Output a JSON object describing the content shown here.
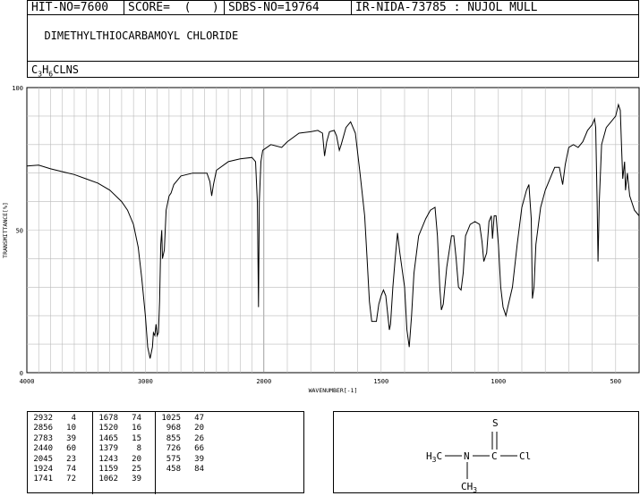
{
  "header": {
    "hit_no": "HIT-NO=7600",
    "score": "SCORE=  (   )",
    "sdbs_no": "SDBS-NO=19764",
    "ir_info": "IR-NIDA-73785 : NUJOL MULL"
  },
  "compound_name": "DIMETHYLTHIOCARBAMOYL CHLORIDE",
  "formula": {
    "c": "C",
    "c_n": "3",
    "h": "H",
    "h_n": "6",
    "rest": "CLNS"
  },
  "chart_data": {
    "type": "line",
    "title": "",
    "xlabel": "WAVENUMBER[-1]",
    "ylabel": "TRANSMITTANCE[%]",
    "xlim": [
      4000,
      400
    ],
    "ylim": [
      0,
      100
    ],
    "x_ticks": [
      4000,
      3000,
      2000,
      1500,
      1000,
      500
    ],
    "y_ticks": [
      0,
      50,
      100
    ],
    "grid": true,
    "series": [
      {
        "points": [
          [
            4000,
            72.5
          ],
          [
            3900,
            72.8
          ],
          [
            3800,
            71.5
          ],
          [
            3700,
            70.5
          ],
          [
            3600,
            69.5
          ],
          [
            3500,
            68
          ],
          [
            3400,
            66.5
          ],
          [
            3300,
            64
          ],
          [
            3200,
            60
          ],
          [
            3150,
            57
          ],
          [
            3100,
            52
          ],
          [
            3060,
            44
          ],
          [
            3030,
            33
          ],
          [
            3000,
            20
          ],
          [
            2980,
            9
          ],
          [
            2960,
            5
          ],
          [
            2940,
            9
          ],
          [
            2932,
            14
          ],
          [
            2920,
            13
          ],
          [
            2910,
            17
          ],
          [
            2900,
            13
          ],
          [
            2890,
            14
          ],
          [
            2880,
            25
          ],
          [
            2870,
            45
          ],
          [
            2862,
            50
          ],
          [
            2856,
            40
          ],
          [
            2840,
            43
          ],
          [
            2825,
            57
          ],
          [
            2800,
            62
          ],
          [
            2783,
            63
          ],
          [
            2760,
            66
          ],
          [
            2700,
            69
          ],
          [
            2600,
            70
          ],
          [
            2480,
            70
          ],
          [
            2455,
            67
          ],
          [
            2440,
            62
          ],
          [
            2425,
            66
          ],
          [
            2400,
            71
          ],
          [
            2300,
            74
          ],
          [
            2200,
            75
          ],
          [
            2100,
            75.5
          ],
          [
            2070,
            74
          ],
          [
            2055,
            60
          ],
          [
            2045,
            23
          ],
          [
            2038,
            60
          ],
          [
            2025,
            74
          ],
          [
            2010,
            78
          ],
          [
            1970,
            80
          ],
          [
            1924,
            79
          ],
          [
            1900,
            81
          ],
          [
            1850,
            84
          ],
          [
            1800,
            84.5
          ],
          [
            1770,
            85
          ],
          [
            1750,
            84
          ],
          [
            1741,
            76
          ],
          [
            1732,
            81
          ],
          [
            1720,
            84.5
          ],
          [
            1700,
            85
          ],
          [
            1690,
            83
          ],
          [
            1678,
            78
          ],
          [
            1670,
            80
          ],
          [
            1650,
            86
          ],
          [
            1630,
            88
          ],
          [
            1610,
            84
          ],
          [
            1590,
            70
          ],
          [
            1570,
            55
          ],
          [
            1560,
            40
          ],
          [
            1550,
            25
          ],
          [
            1540,
            18
          ],
          [
            1520,
            18
          ],
          [
            1510,
            24
          ],
          [
            1500,
            27
          ],
          [
            1490,
            29
          ],
          [
            1480,
            27
          ],
          [
            1465,
            15
          ],
          [
            1460,
            17
          ],
          [
            1450,
            30
          ],
          [
            1440,
            40
          ],
          [
            1430,
            49
          ],
          [
            1420,
            42
          ],
          [
            1400,
            30
          ],
          [
            1390,
            15
          ],
          [
            1380,
            9
          ],
          [
            1370,
            20
          ],
          [
            1360,
            35
          ],
          [
            1340,
            48
          ],
          [
            1310,
            54
          ],
          [
            1290,
            57
          ],
          [
            1270,
            58
          ],
          [
            1260,
            48
          ],
          [
            1250,
            30
          ],
          [
            1243,
            22
          ],
          [
            1235,
            24
          ],
          [
            1220,
            37
          ],
          [
            1200,
            48
          ],
          [
            1190,
            48
          ],
          [
            1180,
            40
          ],
          [
            1170,
            30
          ],
          [
            1159,
            29
          ],
          [
            1150,
            35
          ],
          [
            1140,
            48
          ],
          [
            1120,
            52
          ],
          [
            1100,
            53
          ],
          [
            1080,
            52
          ],
          [
            1070,
            46
          ],
          [
            1062,
            39
          ],
          [
            1050,
            42
          ],
          [
            1040,
            53
          ],
          [
            1030,
            55
          ],
          [
            1025,
            47
          ],
          [
            1018,
            55
          ],
          [
            1010,
            55
          ],
          [
            1000,
            45
          ],
          [
            990,
            30
          ],
          [
            980,
            23
          ],
          [
            968,
            20
          ],
          [
            960,
            23
          ],
          [
            940,
            30
          ],
          [
            920,
            45
          ],
          [
            900,
            58
          ],
          [
            880,
            64
          ],
          [
            870,
            66
          ],
          [
            860,
            54
          ],
          [
            855,
            26
          ],
          [
            848,
            30
          ],
          [
            840,
            45
          ],
          [
            820,
            58
          ],
          [
            800,
            64
          ],
          [
            780,
            68
          ],
          [
            760,
            72
          ],
          [
            740,
            72
          ],
          [
            726,
            66
          ],
          [
            715,
            73
          ],
          [
            700,
            79
          ],
          [
            680,
            80
          ],
          [
            660,
            79
          ],
          [
            640,
            81
          ],
          [
            620,
            85
          ],
          [
            600,
            87
          ],
          [
            590,
            89
          ],
          [
            585,
            86
          ],
          [
            579,
            60
          ],
          [
            575,
            39
          ],
          [
            570,
            60
          ],
          [
            560,
            80
          ],
          [
            540,
            86
          ],
          [
            520,
            88
          ],
          [
            500,
            90
          ],
          [
            488,
            94
          ],
          [
            480,
            92
          ],
          [
            475,
            80
          ],
          [
            470,
            68
          ],
          [
            462,
            74
          ],
          [
            458,
            64
          ],
          [
            450,
            70
          ],
          [
            440,
            62
          ],
          [
            420,
            57
          ],
          [
            400,
            55
          ]
        ]
      }
    ]
  },
  "peak_table": [
    [
      [
        "2932",
        "4"
      ],
      [
        "2856",
        "10"
      ],
      [
        "2783",
        "39"
      ],
      [
        "2440",
        "60"
      ],
      [
        "2045",
        "23"
      ],
      [
        "1924",
        "74"
      ],
      [
        "1741",
        "72"
      ]
    ],
    [
      [
        "1678",
        "74"
      ],
      [
        "1520",
        "16"
      ],
      [
        "1465",
        "15"
      ],
      [
        "1379",
        "8"
      ],
      [
        "1243",
        "20"
      ],
      [
        "1159",
        "25"
      ],
      [
        "1062",
        "39"
      ]
    ],
    [
      [
        "1025",
        "47"
      ],
      [
        "968",
        "20"
      ],
      [
        "855",
        "26"
      ],
      [
        "726",
        "66"
      ],
      [
        "575",
        "39"
      ],
      [
        "458",
        "84"
      ]
    ]
  ],
  "structure": {
    "s_label": "S",
    "left_group": "H3C",
    "n_label": "N",
    "c_label": "C",
    "cl_label": "Cl",
    "bottom_group": "CH3"
  }
}
